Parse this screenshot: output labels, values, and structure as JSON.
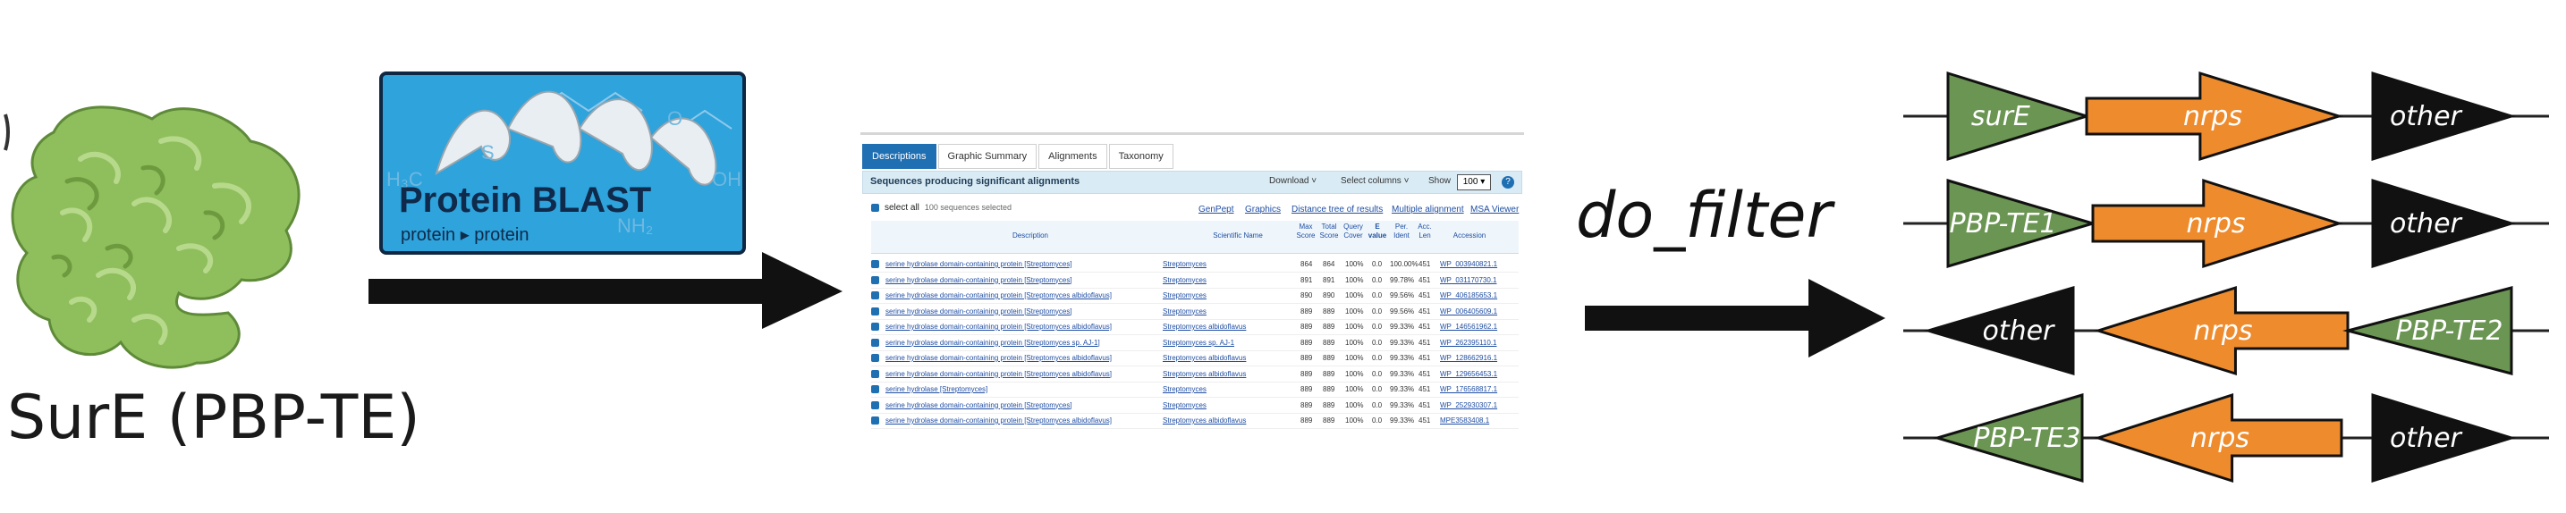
{
  "protein": {
    "label": "SurE (PBP-TE)",
    "color": "#8fbf5c"
  },
  "blast": {
    "title": "Protein BLAST",
    "subtitle": "protein ▸ protein",
    "background": "#2ea3dc",
    "formula_labels": [
      "H₃C",
      "S",
      "O",
      "OH",
      "NH₂"
    ]
  },
  "results": {
    "tabs": [
      "Descriptions",
      "Graphic Summary",
      "Alignments",
      "Taxonomy"
    ],
    "heading": "Sequences producing significant alignments",
    "download": "Download ˅",
    "select_columns": "Select columns ˅",
    "show_label": "Show",
    "show_value": "100 ▾",
    "help": "?",
    "select_all": "select all",
    "selected_count": "100 sequences selected",
    "links": [
      "GenPept",
      "Graphics",
      "Distance tree of results",
      "Multiple alignment",
      "MSA Viewer"
    ],
    "columns": [
      "Description",
      "Scientific Name",
      "Max Score",
      "Total Score",
      "Query Cover",
      "E value",
      "Per. Ident",
      "Acc. Len",
      "Accession"
    ],
    "rows": [
      [
        "serine hydrolase domain-containing protein [Streptomyces]",
        "Streptomyces",
        "864",
        "864",
        "100%",
        "0.0",
        "100.00%",
        "451",
        "WP_003940821.1"
      ],
      [
        "serine hydrolase domain-containing protein [Streptomyces]",
        "Streptomyces",
        "891",
        "891",
        "100%",
        "0.0",
        "99.78%",
        "451",
        "WP_031170730.1"
      ],
      [
        "serine hydrolase domain-containing protein [Streptomyces albidoflavus]",
        "Streptomyces",
        "890",
        "890",
        "100%",
        "0.0",
        "99.56%",
        "451",
        "WP_406185653.1"
      ],
      [
        "serine hydrolase domain-containing protein [Streptomyces]",
        "Streptomyces",
        "889",
        "889",
        "100%",
        "0.0",
        "99.56%",
        "451",
        "WP_006405609.1"
      ],
      [
        "serine hydrolase domain-containing protein [Streptomyces albidoflavus]",
        "Streptomyces albidoflavus",
        "889",
        "889",
        "100%",
        "0.0",
        "99.33%",
        "451",
        "WP_146561962.1"
      ],
      [
        "serine hydrolase domain-containing protein [Streptomyces sp. AJ-1]",
        "Streptomyces sp. AJ-1",
        "889",
        "889",
        "100%",
        "0.0",
        "99.33%",
        "451",
        "WP_262395110.1"
      ],
      [
        "serine hydrolase domain-containing protein [Streptomyces albidoflavus]",
        "Streptomyces albidoflavus",
        "889",
        "889",
        "100%",
        "0.0",
        "99.33%",
        "451",
        "WP_128662916.1"
      ],
      [
        "serine hydrolase domain-containing protein [Streptomyces albidoflavus]",
        "Streptomyces albidoflavus",
        "889",
        "889",
        "100%",
        "0.0",
        "99.33%",
        "451",
        "WP_129656453.1"
      ],
      [
        "serine hydrolase [Streptomyces]",
        "Streptomyces",
        "889",
        "889",
        "100%",
        "0.0",
        "99.33%",
        "451",
        "WP_176568817.1"
      ],
      [
        "serine hydrolase domain-containing protein [Streptomyces]",
        "Streptomyces",
        "889",
        "889",
        "100%",
        "0.0",
        "99.33%",
        "451",
        "WP_252930307.1"
      ],
      [
        "serine hydrolase domain-containing protein [Streptomyces albidoflavus]",
        "Streptomyces albidoflavus",
        "889",
        "889",
        "100%",
        "0.0",
        "99.33%",
        "451",
        "MPE3583408.1"
      ]
    ]
  },
  "filter": {
    "label": "do_filter"
  },
  "clusters": {
    "colors": {
      "green": "#6b9552",
      "orange": "#ee8b2d",
      "black": "#111111",
      "line": "#222222"
    },
    "rows": [
      [
        {
          "label": "surE",
          "color": "green",
          "dir": "right"
        },
        {
          "label": "nrps",
          "color": "orange",
          "dir": "right"
        },
        {
          "label": "other",
          "color": "black",
          "dir": "right"
        }
      ],
      [
        {
          "label": "PBP-TE1",
          "color": "green",
          "dir": "right"
        },
        {
          "label": "nrps",
          "color": "orange",
          "dir": "right"
        },
        {
          "label": "other",
          "color": "black",
          "dir": "right"
        }
      ],
      [
        {
          "label": "other",
          "color": "black",
          "dir": "left"
        },
        {
          "label": "nrps",
          "color": "orange",
          "dir": "left"
        },
        {
          "label": "PBP-TE2",
          "color": "green",
          "dir": "left"
        }
      ],
      [
        {
          "label": "PBP-TE3",
          "color": "green",
          "dir": "left"
        },
        {
          "label": "nrps",
          "color": "orange",
          "dir": "left"
        },
        {
          "label": "other",
          "color": "black",
          "dir": "right"
        }
      ]
    ]
  }
}
